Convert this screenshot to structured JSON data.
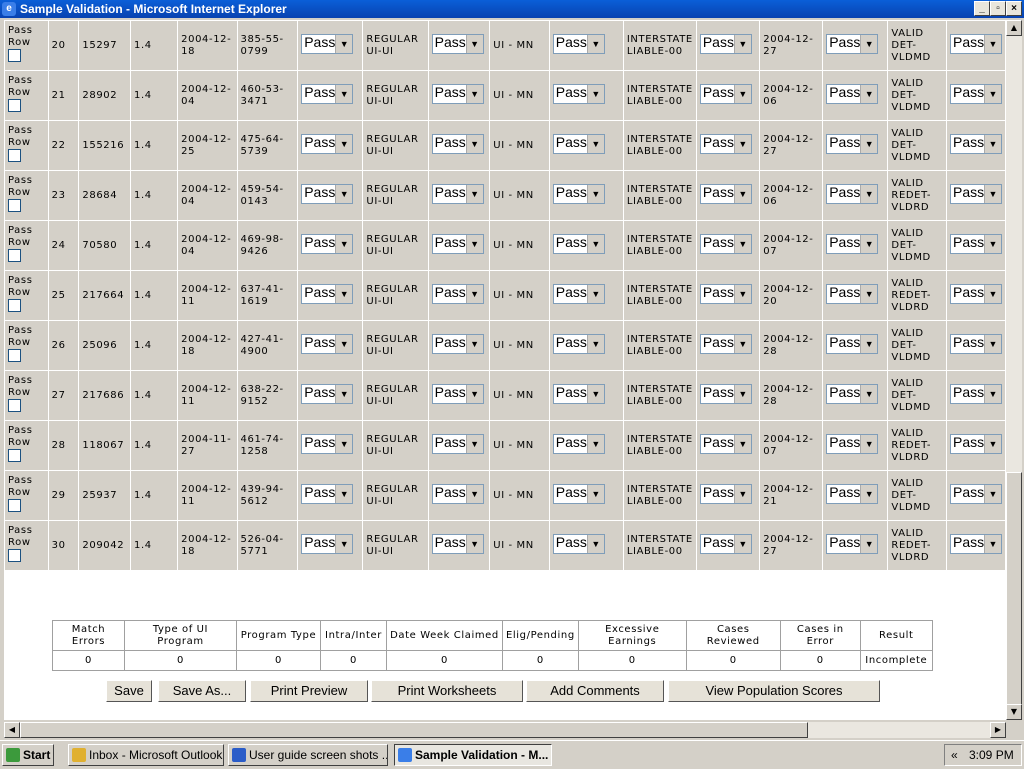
{
  "window": {
    "title": "Sample Validation - Microsoft Internet Explorer"
  },
  "rows": [
    {
      "label": "Pass Row",
      "num": "20",
      "id": "15297",
      "ver": "1.4",
      "date1": "2004-12-18",
      "ssn": "385-55-0799",
      "pass1": "Pass",
      "prog": "REGULAR UI-UI",
      "pass2": "Pass",
      "type": "UI - MN",
      "pass3": "Pass",
      "inter": "INTERSTATE LIABLE-00",
      "pass4": "Pass",
      "date2": "2004-12-27",
      "pass5": "Pass",
      "result": "VALID DET-VLDMD",
      "pass6": "Pass"
    },
    {
      "label": "Pass Row",
      "num": "21",
      "id": "28902",
      "ver": "1.4",
      "date1": "2004-12-04",
      "ssn": "460-53-3471",
      "pass1": "Pass",
      "prog": "REGULAR UI-UI",
      "pass2": "Pass",
      "type": "UI - MN",
      "pass3": "Pass",
      "inter": "INTERSTATE LIABLE-00",
      "pass4": "Pass",
      "date2": "2004-12-06",
      "pass5": "Pass",
      "result": "VALID DET-VLDMD",
      "pass6": "Pass"
    },
    {
      "label": "Pass Row",
      "num": "22",
      "id": "155216",
      "ver": "1.4",
      "date1": "2004-12-25",
      "ssn": "475-64-5739",
      "pass1": "Pass",
      "prog": "REGULAR UI-UI",
      "pass2": "Pass",
      "type": "UI - MN",
      "pass3": "Pass",
      "inter": "INTERSTATE LIABLE-00",
      "pass4": "Pass",
      "date2": "2004-12-27",
      "pass5": "Pass",
      "result": "VALID DET-VLDMD",
      "pass6": "Pass"
    },
    {
      "label": "Pass Row",
      "num": "23",
      "id": "28684",
      "ver": "1.4",
      "date1": "2004-12-04",
      "ssn": "459-54-0143",
      "pass1": "Pass",
      "prog": "REGULAR UI-UI",
      "pass2": "Pass",
      "type": "UI - MN",
      "pass3": "Pass",
      "inter": "INTERSTATE LIABLE-00",
      "pass4": "Pass",
      "date2": "2004-12-06",
      "pass5": "Pass",
      "result": "VALID REDET-VLDRD",
      "pass6": "Pass"
    },
    {
      "label": "Pass Row",
      "num": "24",
      "id": "70580",
      "ver": "1.4",
      "date1": "2004-12-04",
      "ssn": "469-98-9426",
      "pass1": "Pass",
      "prog": "REGULAR UI-UI",
      "pass2": "Pass",
      "type": "UI - MN",
      "pass3": "Pass",
      "inter": "INTERSTATE LIABLE-00",
      "pass4": "Pass",
      "date2": "2004-12-07",
      "pass5": "Pass",
      "result": "VALID DET-VLDMD",
      "pass6": "Pass"
    },
    {
      "label": "Pass Row",
      "num": "25",
      "id": "217664",
      "ver": "1.4",
      "date1": "2004-12-11",
      "ssn": "637-41-1619",
      "pass1": "Pass",
      "prog": "REGULAR UI-UI",
      "pass2": "Pass",
      "type": "UI - MN",
      "pass3": "Pass",
      "inter": "INTERSTATE LIABLE-00",
      "pass4": "Pass",
      "date2": "2004-12-20",
      "pass5": "Pass",
      "result": "VALID REDET-VLDRD",
      "pass6": "Pass"
    },
    {
      "label": "Pass Row",
      "num": "26",
      "id": "25096",
      "ver": "1.4",
      "date1": "2004-12-18",
      "ssn": "427-41-4900",
      "pass1": "Pass",
      "prog": "REGULAR UI-UI",
      "pass2": "Pass",
      "type": "UI - MN",
      "pass3": "Pass",
      "inter": "INTERSTATE LIABLE-00",
      "pass4": "Pass",
      "date2": "2004-12-28",
      "pass5": "Pass",
      "result": "VALID DET-VLDMD",
      "pass6": "Pass"
    },
    {
      "label": "Pass Row",
      "num": "27",
      "id": "217686",
      "ver": "1.4",
      "date1": "2004-12-11",
      "ssn": "638-22-9152",
      "pass1": "Pass",
      "prog": "REGULAR UI-UI",
      "pass2": "Pass",
      "type": "UI - MN",
      "pass3": "Pass",
      "inter": "INTERSTATE LIABLE-00",
      "pass4": "Pass",
      "date2": "2004-12-28",
      "pass5": "Pass",
      "result": "VALID DET-VLDMD",
      "pass6": "Pass"
    },
    {
      "label": "Pass Row",
      "num": "28",
      "id": "118067",
      "ver": "1.4",
      "date1": "2004-11-27",
      "ssn": "461-74-1258",
      "pass1": "Pass",
      "prog": "REGULAR UI-UI",
      "pass2": "Pass",
      "type": "UI - MN",
      "pass3": "Pass",
      "inter": "INTERSTATE LIABLE-00",
      "pass4": "Pass",
      "date2": "2004-12-07",
      "pass5": "Pass",
      "result": "VALID REDET-VLDRD",
      "pass6": "Pass"
    },
    {
      "label": "Pass Row",
      "num": "29",
      "id": "25937",
      "ver": "1.4",
      "date1": "2004-12-11",
      "ssn": "439-94-5612",
      "pass1": "Pass",
      "prog": "REGULAR UI-UI",
      "pass2": "Pass",
      "type": "UI - MN",
      "pass3": "Pass",
      "inter": "INTERSTATE LIABLE-00",
      "pass4": "Pass",
      "date2": "2004-12-21",
      "pass5": "Pass",
      "result": "VALID DET-VLDMD",
      "pass6": "Pass"
    },
    {
      "label": "Pass Row",
      "num": "30",
      "id": "209042",
      "ver": "1.4",
      "date1": "2004-12-18",
      "ssn": "526-04-5771",
      "pass1": "Pass",
      "prog": "REGULAR UI-UI",
      "pass2": "Pass",
      "type": "UI - MN",
      "pass3": "Pass",
      "inter": "INTERSTATE LIABLE-00",
      "pass4": "Pass",
      "date2": "2004-12-27",
      "pass5": "Pass",
      "result": "VALID REDET-VLDRD",
      "pass6": "Pass"
    }
  ],
  "summary": {
    "headers": [
      "Match Errors",
      "Type of UI Program",
      "Program Type",
      "Intra/Inter",
      "Date Week Claimed",
      "Elig/Pending",
      "Excessive Earnings",
      "Cases Reviewed",
      "Cases in Error",
      "Result"
    ],
    "values": [
      "0",
      "0",
      "0",
      "0",
      "0",
      "0",
      "0",
      "0",
      "0",
      "Incomplete"
    ]
  },
  "buttons": {
    "save": "Save",
    "save_as": "Save As...",
    "print_preview": "Print Preview",
    "print_worksheets": "Print Worksheets",
    "add_comments": "Add Comments",
    "view_population_scores": "View Population Scores"
  },
  "taskbar": {
    "start": "Start",
    "items": [
      "Inbox - Microsoft Outlook",
      "User guide screen shots ...",
      "Sample Validation - M..."
    ],
    "clock": "3:09 PM",
    "tray_arrow": "«"
  },
  "colors": {
    "titlebar": "#0a5fd8",
    "start": "#3c9a3c"
  }
}
